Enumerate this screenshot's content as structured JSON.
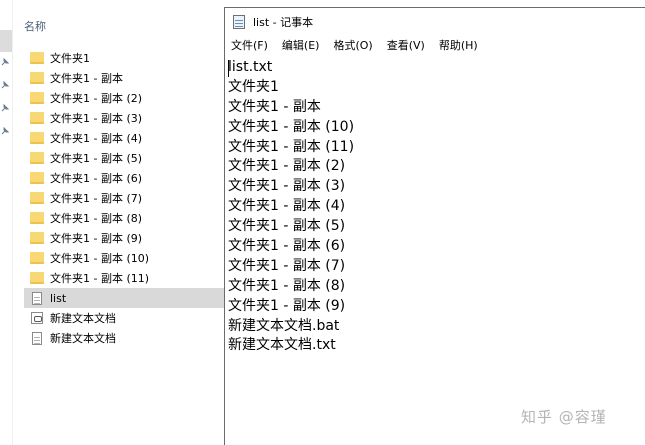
{
  "explorer": {
    "column_header": "名称",
    "files": [
      {
        "name": "文件夹1",
        "type": "folder",
        "icon": "folder-icon"
      },
      {
        "name": "文件夹1 - 副本",
        "type": "folder",
        "icon": "folder-icon"
      },
      {
        "name": "文件夹1 - 副本 (2)",
        "type": "folder",
        "icon": "folder-icon"
      },
      {
        "name": "文件夹1 - 副本 (3)",
        "type": "folder",
        "icon": "folder-icon"
      },
      {
        "name": "文件夹1 - 副本 (4)",
        "type": "folder",
        "icon": "folder-icon"
      },
      {
        "name": "文件夹1 - 副本 (5)",
        "type": "folder",
        "icon": "folder-icon"
      },
      {
        "name": "文件夹1 - 副本 (6)",
        "type": "folder",
        "icon": "folder-icon"
      },
      {
        "name": "文件夹1 - 副本 (7)",
        "type": "folder",
        "icon": "folder-icon"
      },
      {
        "name": "文件夹1 - 副本 (8)",
        "type": "folder",
        "icon": "folder-icon"
      },
      {
        "name": "文件夹1 - 副本 (9)",
        "type": "folder",
        "icon": "folder-icon"
      },
      {
        "name": "文件夹1 - 副本 (10)",
        "type": "folder",
        "icon": "folder-icon"
      },
      {
        "name": "文件夹1 - 副本 (11)",
        "type": "folder",
        "icon": "folder-icon"
      },
      {
        "name": "list",
        "type": "text",
        "icon": "text-file-icon",
        "selected": true
      },
      {
        "name": "新建文本文档",
        "type": "bat",
        "icon": "batch-file-icon"
      },
      {
        "name": "新建文本文档",
        "type": "text",
        "icon": "text-file-icon"
      }
    ]
  },
  "notepad": {
    "title": "list - 记事本",
    "menu": [
      "文件(F)",
      "编辑(E)",
      "格式(O)",
      "查看(V)",
      "帮助(H)"
    ],
    "lines": [
      "list.txt",
      "文件夹1",
      "文件夹1 - 副本",
      "文件夹1 - 副本 (10)",
      "文件夹1 - 副本 (11)",
      "文件夹1 - 副本 (2)",
      "文件夹1 - 副本 (3)",
      "文件夹1 - 副本 (4)",
      "文件夹1 - 副本 (5)",
      "文件夹1 - 副本 (6)",
      "文件夹1 - 副本 (7)",
      "文件夹1 - 副本 (8)",
      "文件夹1 - 副本 (9)",
      "新建文本文档.bat",
      "新建文本文档.txt"
    ]
  },
  "watermark": "知乎 @容瑾",
  "colors": {
    "folder": "#f8d775",
    "selection": "#d9d9d9",
    "header_text": "#4c607a",
    "watermark": "#b4b4b4"
  }
}
